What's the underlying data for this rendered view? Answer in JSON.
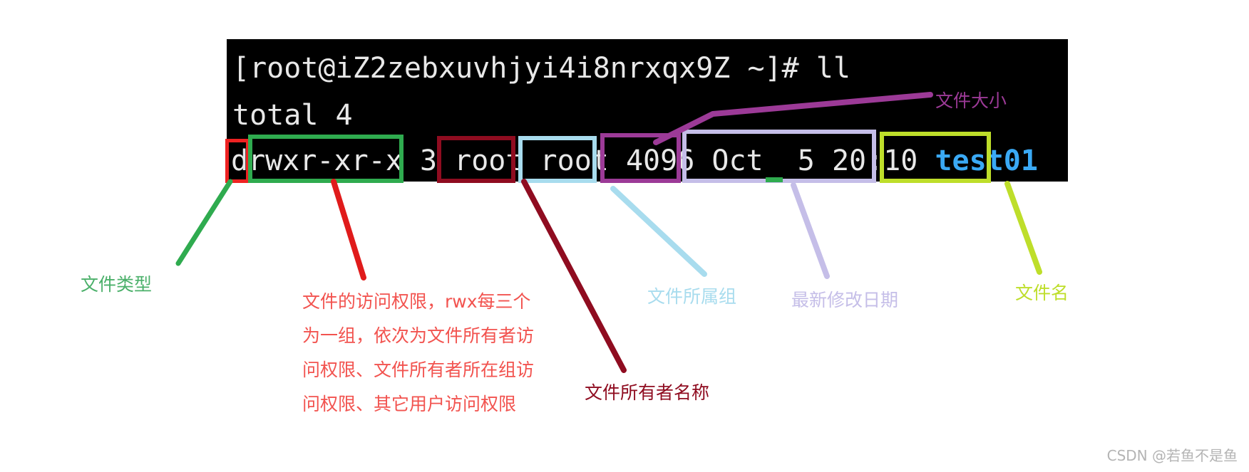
{
  "terminal": {
    "prompt_line": "[root@iZ2zebxuvhjyi4i8nrxqx9Z ~]# ll",
    "total_line": "total 4",
    "listing": {
      "file_type": "d",
      "permissions": "rwxr-xr-x",
      "link_count": "3",
      "owner": "root",
      "group": "root",
      "size": "4096",
      "mtime": "Oct  5 20:10",
      "filename": "test01"
    },
    "background_color": "#000000",
    "text_color": "#e8e8e8",
    "directory_color": "#3aa9f5"
  },
  "annotations": {
    "file_type": {
      "label": "文件类型",
      "color": "#3cab63"
    },
    "permissions": {
      "label": "文件的访问权限，rwx每三个为一组，依次为文件所有者访问权限、文件所有者所在组访问权限、其它用户访问权限",
      "color": "#f2534f"
    },
    "owner": {
      "label": "文件所有者名称",
      "color": "#8f0c20"
    },
    "group": {
      "label": "文件所属组",
      "color": "#a8dcee"
    },
    "mtime": {
      "label": "最新修改日期",
      "color": "#c5bee8"
    },
    "file_size": {
      "label": "文件大小",
      "color": "#9c3a97"
    },
    "file_name": {
      "label": "文件名",
      "color": "#bede2a"
    }
  },
  "highlight_colors": {
    "file_type_box": "#ee2222",
    "permissions_box": "#2fab4f",
    "owner_box": "#8f0c20",
    "group_box": "#a8dcee",
    "size_box": "#9c3a97",
    "mtime_box": "#c5bee8",
    "filename_box": "#bede2a"
  },
  "watermark": "CSDN @若鱼不是鱼"
}
